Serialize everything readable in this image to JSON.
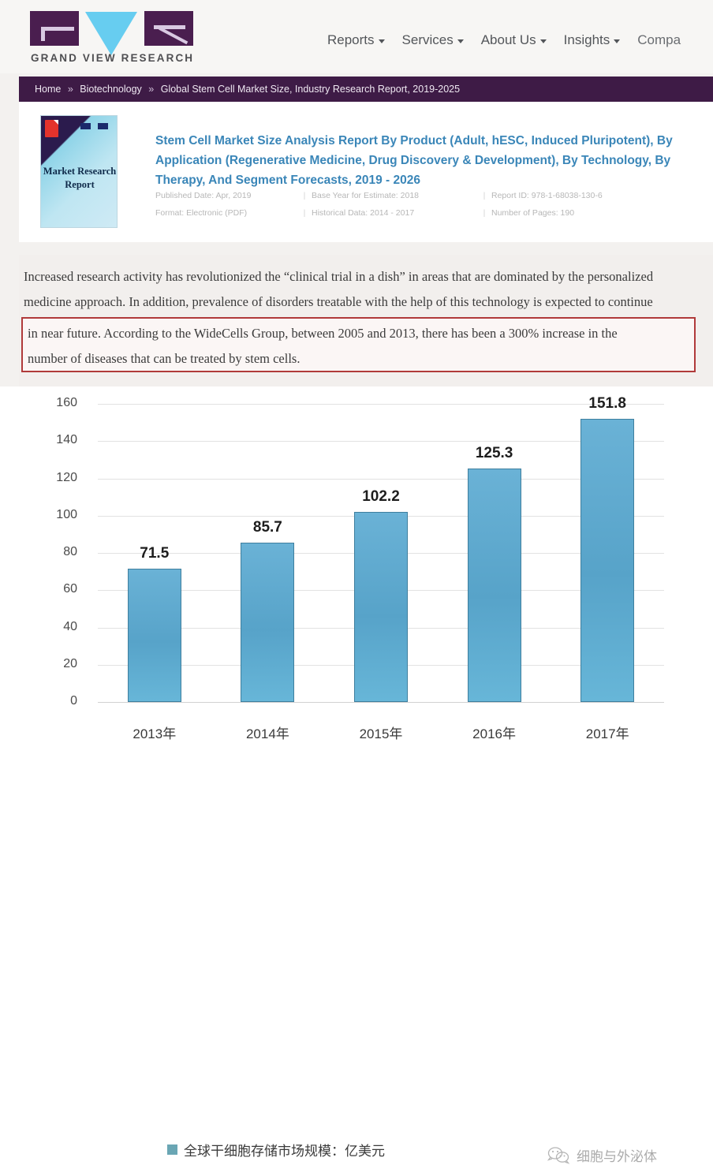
{
  "site": {
    "logo_wordmark": "GRAND VIEW RESEARCH",
    "nav": [
      {
        "label": "Reports",
        "has_caret": true
      },
      {
        "label": "Services",
        "has_caret": true
      },
      {
        "label": "About Us",
        "has_caret": true
      },
      {
        "label": "Insights",
        "has_caret": true
      },
      {
        "label": "Compa",
        "has_caret": false
      }
    ],
    "breadcrumb": {
      "home": "Home",
      "category": "Biotechnology",
      "current": "Global Stem Cell Market Size, Industry Research Report, 2019-2025",
      "separator": "»"
    }
  },
  "report": {
    "thumbnail_text": "Market Research Report",
    "thumbnail_icon": "pdf-icon",
    "title": "Stem Cell Market Size Analysis Report By Product (Adult, hESC, Induced Pluripotent), By Application (Regenerative Medicine, Drug Discovery & Development), By Technology, By Therapy, And Segment Forecasts, 2019 - 2026",
    "meta": {
      "published_date": "Published Date: Apr, 2019",
      "base_year": "Base Year for Estimate: 2018",
      "report_id": "Report ID: 978-1-68038-130-6",
      "format": "Format: Electronic (PDF)",
      "historical_data": "Historical Data: 2014 - 2017",
      "pages": "Number of Pages: 190"
    }
  },
  "article": {
    "line1": "Increased research activity has revolutionized the “clinical trial in a dish” in areas that are dominated by the personalized",
    "line2": "medicine approach. In addition, prevalence of disorders treatable with the help of this technology is expected to continue",
    "highlight_line1": "in near future. According to the WideCells Group, between 2005 and 2013, there has been a 300% increase in the",
    "highlight_line2": "number of diseases that can be treated by stem cells.",
    "highlight_border_color": "#b03a3a"
  },
  "chart_data": {
    "type": "bar",
    "title": "",
    "categories": [
      "2013年",
      "2014年",
      "2015年",
      "2016年",
      "2017年"
    ],
    "values": [
      71.5,
      85.7,
      102.2,
      125.3,
      151.8
    ],
    "value_labels": [
      "71.5",
      "85.7",
      "102.2",
      "125.3",
      "151.8"
    ],
    "ylim": [
      0,
      160
    ],
    "yticks": [
      160,
      140,
      120,
      100,
      80,
      60,
      40,
      20,
      0
    ],
    "ytick_labels": [
      "160",
      "140",
      "120",
      "100",
      "80",
      "60",
      "40",
      "20",
      "0"
    ],
    "xlabel": "",
    "ylabel": "",
    "grid": true,
    "legend_position": "bottom",
    "legend": [
      "全球干细胞存储市场规模：亿美元"
    ],
    "series_color": "#5FAAD0",
    "legend_swatch_color": "#6aa6b4"
  },
  "watermark": {
    "icon": "wechat-icon",
    "label": "细胞与外泌体"
  }
}
